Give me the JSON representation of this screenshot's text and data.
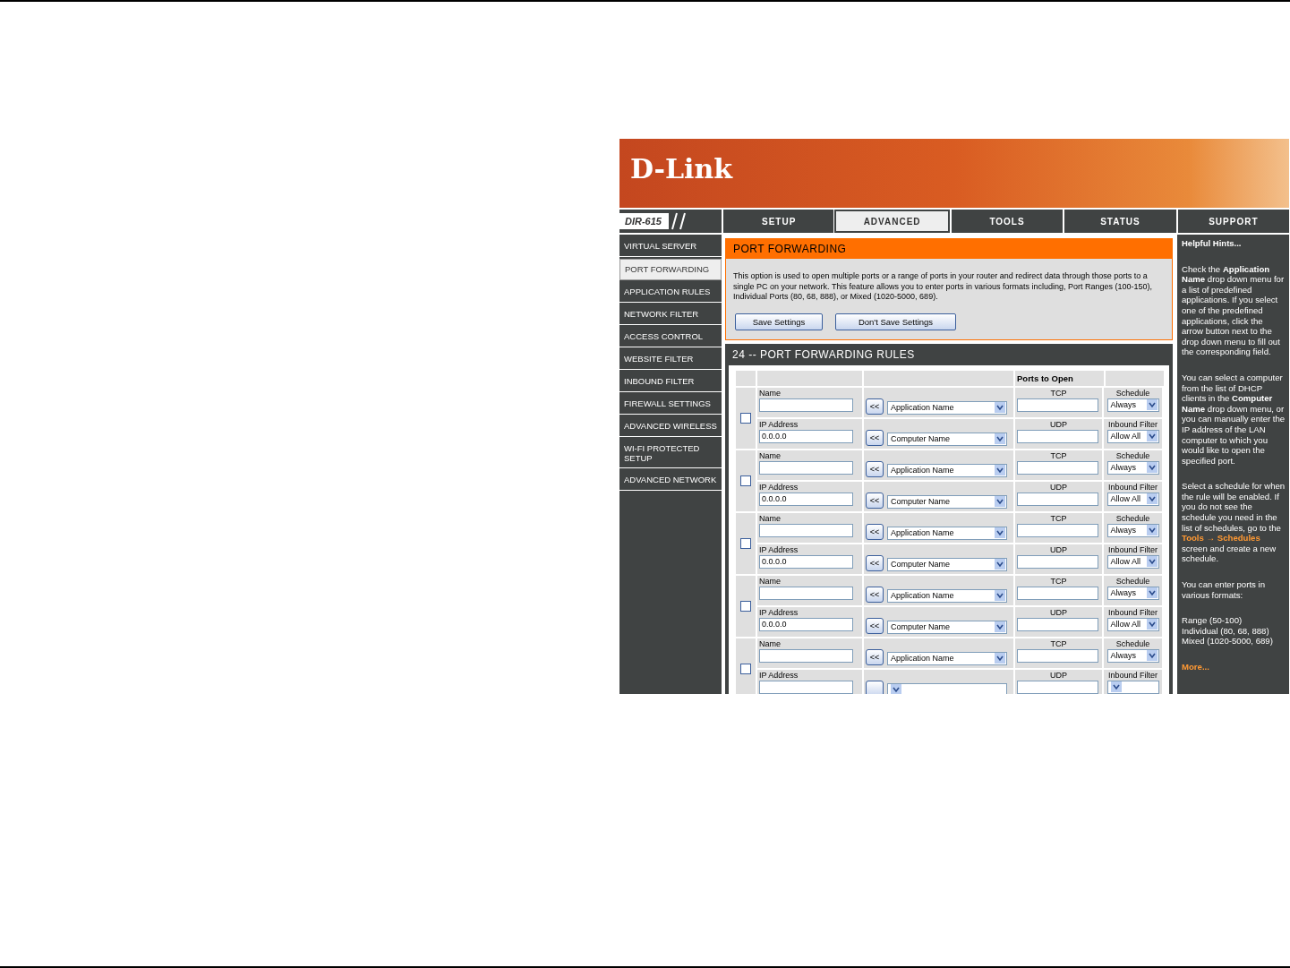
{
  "banner": {
    "logo": "D-Link",
    "model": "DIR-615"
  },
  "tabs": [
    {
      "label": "SETUP",
      "selected": false
    },
    {
      "label": "ADVANCED",
      "selected": true
    },
    {
      "label": "TOOLS",
      "selected": false
    },
    {
      "label": "STATUS",
      "selected": false
    },
    {
      "label": "SUPPORT",
      "selected": false
    }
  ],
  "sidebar": {
    "items": [
      {
        "label": "VIRTUAL SERVER",
        "selected": false
      },
      {
        "label": "PORT FORWARDING",
        "selected": true
      },
      {
        "label": "APPLICATION RULES",
        "selected": false
      },
      {
        "label": "NETWORK FILTER",
        "selected": false
      },
      {
        "label": "ACCESS CONTROL",
        "selected": false
      },
      {
        "label": "WEBSITE FILTER",
        "selected": false
      },
      {
        "label": "INBOUND FILTER",
        "selected": false
      },
      {
        "label": "FIREWALL SETTINGS",
        "selected": false
      },
      {
        "label": "ADVANCED WIRELESS",
        "selected": false
      },
      {
        "label": "WI-FI PROTECTED SETUP",
        "selected": false
      },
      {
        "label": "ADVANCED NETWORK",
        "selected": false
      }
    ]
  },
  "section": {
    "title": "PORT FORWARDING",
    "description": "This option is used to open multiple ports or a range of ports in your router and redirect data through those ports to a single PC on your network. This feature allows you to enter ports in various formats including, Port Ranges (100-150), Individual Ports (80, 68, 888), or Mixed (1020-5000, 689).",
    "buttons": [
      "Save Settings",
      "Don't Save Settings"
    ]
  },
  "rules": {
    "title": "24 -- PORT FORWARDING RULES",
    "ports_heading": "Ports to Open",
    "rows": [
      {
        "checked": false,
        "name_label": "Name",
        "ip_label": "IP Address",
        "ip_address": "0.0.0.0",
        "arrow_1": "<<",
        "arrow_2": "<<",
        "application": "Application Name",
        "computer": "Computer Name",
        "tcp_label": "TCP",
        "udp_label": "UDP",
        "schedule_label": "Schedule",
        "schedule": "Always",
        "filter_label": "Inbound Filter",
        "filter": "Allow All"
      },
      {
        "checked": false,
        "name_label": "Name",
        "ip_label": "IP Address",
        "ip_address": "0.0.0.0",
        "arrow_1": "<<",
        "arrow_2": "<<",
        "application": "Application Name",
        "computer": "Computer Name",
        "tcp_label": "TCP",
        "udp_label": "UDP",
        "schedule_label": "Schedule",
        "schedule": "Always",
        "filter_label": "Inbound Filter",
        "filter": "Allow All"
      },
      {
        "checked": false,
        "name_label": "Name",
        "ip_label": "IP Address",
        "ip_address": "0.0.0.0",
        "arrow_1": "<<",
        "arrow_2": "<<",
        "application": "Application Name",
        "computer": "Computer Name",
        "tcp_label": "TCP",
        "udp_label": "UDP",
        "schedule_label": "Schedule",
        "schedule": "Always",
        "filter_label": "Inbound Filter",
        "filter": "Allow All"
      },
      {
        "checked": false,
        "name_label": "Name",
        "ip_label": "IP Address",
        "ip_address": "0.0.0.0",
        "arrow_1": "<<",
        "arrow_2": "<<",
        "application": "Application Name",
        "computer": "Computer Name",
        "tcp_label": "TCP",
        "udp_label": "UDP",
        "schedule_label": "Schedule",
        "schedule": "Always",
        "filter_label": "Inbound Filter",
        "filter": "Allow All"
      },
      {
        "checked": false,
        "name_label": "Name",
        "ip_label": "IP Address",
        "arrow_1": "<<",
        "application": "Application Name",
        "tcp_label": "TCP",
        "udp_label": "UDP",
        "schedule_label": "Schedule",
        "schedule": "Always",
        "filter_label": "Inbound Filter"
      }
    ]
  },
  "hints": {
    "title": "Helpful Hints...",
    "paragraphs": [
      {
        "text": "Check the **Application Name** drop down menu for a list of predefined applications. If you select one of the predefined applications, click the arrow button next to the drop down menu to fill out the corresponding field."
      },
      {
        "text": "You can select a computer from the list of DHCP clients in the **Computer Name** drop down menu, or you can manually enter the IP address of the LAN computer to which you would like to open the specified port."
      },
      {
        "text": "Select a schedule for when the rule will be enabled. If you do not see the schedule you need in the list of schedules, go to the",
        "link": "Tools → Schedules",
        "after": "screen and create a new schedule."
      },
      {
        "text": "You can enter ports in various formats:"
      },
      {
        "lines": [
          "Range (50-100)",
          "Individual (80, 68, 888)",
          "Mixed (1020-5000, 689)"
        ]
      }
    ],
    "more": "More..."
  }
}
